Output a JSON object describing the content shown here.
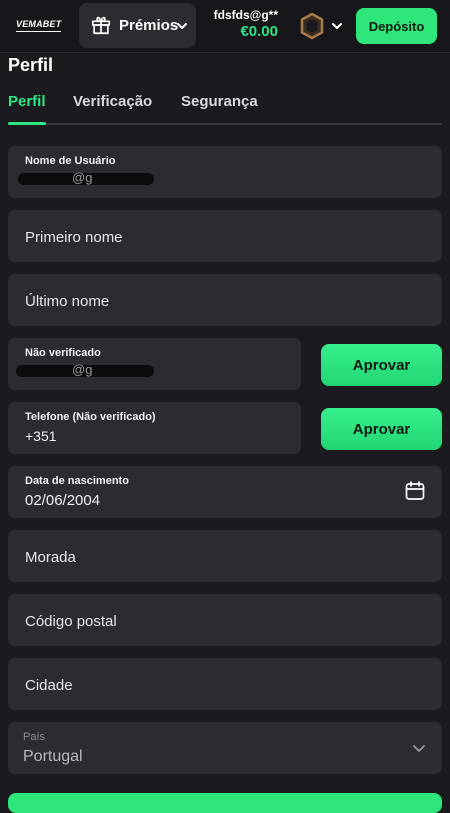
{
  "header": {
    "logo_text": "VEMABET",
    "prizes_label": "Prémios",
    "user_email": "fdsfds@g**",
    "balance": "€0.00",
    "deposit_label": "Depósito"
  },
  "page": {
    "title": "Perfil",
    "tabs": [
      "Perfil",
      "Verificação",
      "Segurança"
    ]
  },
  "form": {
    "username_label": "Nome de Usuário",
    "username_value": "@g",
    "first_name_placeholder": "Primeiro nome",
    "last_name_placeholder": "Último nome",
    "email_label": "Não verificado",
    "email_value": "@g",
    "approve_email_label": "Aprovar",
    "phone_label": "Telefone (Não verificado)",
    "phone_value": "+351",
    "approve_phone_label": "Aprovar",
    "dob_label": "Data de nascimento",
    "dob_value": "02/06/2004",
    "address_placeholder": "Morada",
    "postal_placeholder": "Código postal",
    "city_placeholder": "Cidade",
    "country_label": "País",
    "country_value": "Portugal"
  },
  "colors": {
    "accent": "#2ee682",
    "background": "#1b1b1f",
    "field": "#2b2b31"
  },
  "icons": [
    "gift-icon",
    "chevron-down-icon",
    "hexagon-badge-icon",
    "calendar-icon"
  ]
}
